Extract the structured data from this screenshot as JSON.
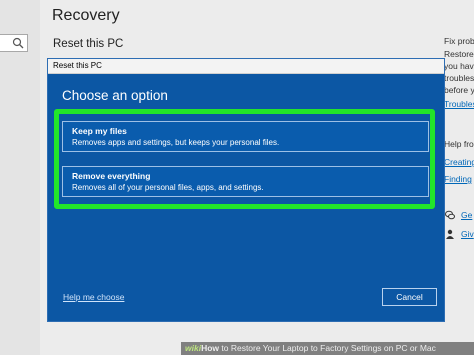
{
  "settings": {
    "page_title": "Recovery",
    "section_title": "Reset this PC",
    "right_column": {
      "fix_heading": "Fix probl",
      "line1": "Restore",
      "line2": "you have",
      "line3": "troubles",
      "line4": "before y",
      "link": "Troubles",
      "help_heading": "Help fro",
      "help_link1": "Creating",
      "help_link2": "Finding",
      "get_help": "Ge",
      "give_feedback": "Giv"
    }
  },
  "dialog": {
    "title": "Reset this PC",
    "heading": "Choose an option",
    "options": [
      {
        "title": "Keep my files",
        "description": "Removes apps and settings, but keeps your personal files."
      },
      {
        "title": "Remove everything",
        "description": "Removes all of your personal files, apps, and settings."
      }
    ],
    "help_link": "Help me choose",
    "cancel_label": "Cancel"
  },
  "watermark": {
    "brand": "wiki",
    "how": "How",
    "text": " to Restore Your Laptop to Factory Settings on PC or Mac"
  },
  "colors": {
    "dialog_blue": "#0c57a4",
    "highlight_green": "#22e52a",
    "link_blue": "#0067b8"
  }
}
